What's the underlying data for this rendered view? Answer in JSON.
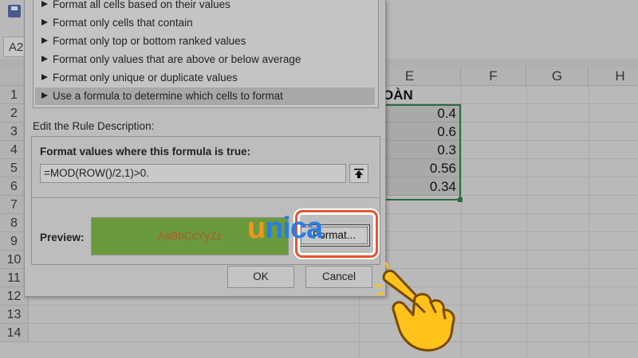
{
  "excel": {
    "name_box": "A2",
    "columns": [
      "E",
      "F",
      "G",
      "H"
    ],
    "rows": [
      "1",
      "2",
      "3",
      "4",
      "5",
      "6",
      "7",
      "8",
      "9",
      "10",
      "11",
      "12",
      "13",
      "14"
    ],
    "header_cell": "OÀN THÀNH",
    "values": [
      "0.4",
      "0.6",
      "0.3",
      "0.56",
      "0.34"
    ]
  },
  "dialog": {
    "rule_types": [
      "Format all cells based on their values",
      "Format only cells that contain",
      "Format only top or bottom ranked values",
      "Format only values that are above or below average",
      "Format only unique or duplicate values",
      "Use a formula to determine which cells to format"
    ],
    "selected_rule_index": 5,
    "edit_rule_label": "Edit the Rule Description:",
    "formula_label": "Format values where this formula is true:",
    "formula_value": "=MOD(ROW()/2,1)>0.",
    "preview_label": "Preview:",
    "preview_sample": "AaBbCcYyZz",
    "preview_fill_color": "#6a9a3d",
    "preview_font_color": "#b4582a",
    "format_button": "Format...",
    "ok_button": "OK",
    "cancel_button": "Cancel"
  },
  "watermark": {
    "logo_u": "u",
    "logo_rest": "nica"
  },
  "colors": {
    "highlight": "#e8552f",
    "selection": "#2b6a3f"
  },
  "icons": [
    "save-icon",
    "collapse-dialog-icon",
    "pointing-hand-icon"
  ]
}
